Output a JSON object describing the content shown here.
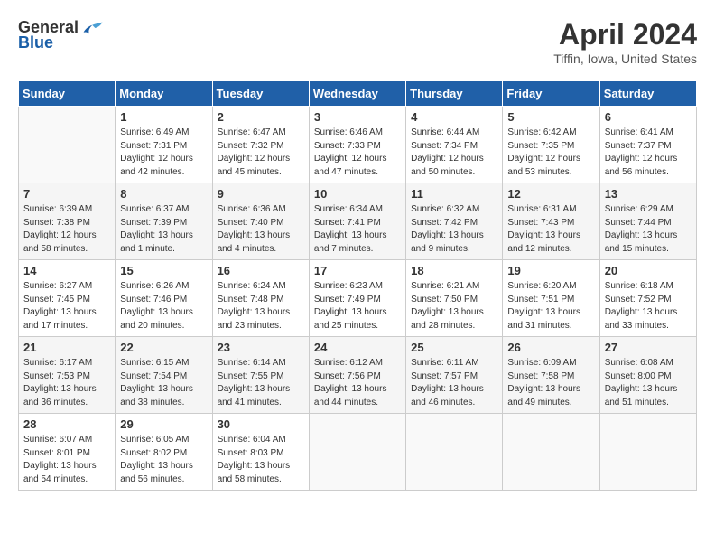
{
  "header": {
    "logo_general": "General",
    "logo_blue": "Blue",
    "title": "April 2024",
    "subtitle": "Tiffin, Iowa, United States"
  },
  "calendar": {
    "headers": [
      "Sunday",
      "Monday",
      "Tuesday",
      "Wednesday",
      "Thursday",
      "Friday",
      "Saturday"
    ],
    "weeks": [
      [
        {
          "day": "",
          "info": ""
        },
        {
          "day": "1",
          "info": "Sunrise: 6:49 AM\nSunset: 7:31 PM\nDaylight: 12 hours\nand 42 minutes."
        },
        {
          "day": "2",
          "info": "Sunrise: 6:47 AM\nSunset: 7:32 PM\nDaylight: 12 hours\nand 45 minutes."
        },
        {
          "day": "3",
          "info": "Sunrise: 6:46 AM\nSunset: 7:33 PM\nDaylight: 12 hours\nand 47 minutes."
        },
        {
          "day": "4",
          "info": "Sunrise: 6:44 AM\nSunset: 7:34 PM\nDaylight: 12 hours\nand 50 minutes."
        },
        {
          "day": "5",
          "info": "Sunrise: 6:42 AM\nSunset: 7:35 PM\nDaylight: 12 hours\nand 53 minutes."
        },
        {
          "day": "6",
          "info": "Sunrise: 6:41 AM\nSunset: 7:37 PM\nDaylight: 12 hours\nand 56 minutes."
        }
      ],
      [
        {
          "day": "7",
          "info": "Sunrise: 6:39 AM\nSunset: 7:38 PM\nDaylight: 12 hours\nand 58 minutes."
        },
        {
          "day": "8",
          "info": "Sunrise: 6:37 AM\nSunset: 7:39 PM\nDaylight: 13 hours\nand 1 minute."
        },
        {
          "day": "9",
          "info": "Sunrise: 6:36 AM\nSunset: 7:40 PM\nDaylight: 13 hours\nand 4 minutes."
        },
        {
          "day": "10",
          "info": "Sunrise: 6:34 AM\nSunset: 7:41 PM\nDaylight: 13 hours\nand 7 minutes."
        },
        {
          "day": "11",
          "info": "Sunrise: 6:32 AM\nSunset: 7:42 PM\nDaylight: 13 hours\nand 9 minutes."
        },
        {
          "day": "12",
          "info": "Sunrise: 6:31 AM\nSunset: 7:43 PM\nDaylight: 13 hours\nand 12 minutes."
        },
        {
          "day": "13",
          "info": "Sunrise: 6:29 AM\nSunset: 7:44 PM\nDaylight: 13 hours\nand 15 minutes."
        }
      ],
      [
        {
          "day": "14",
          "info": "Sunrise: 6:27 AM\nSunset: 7:45 PM\nDaylight: 13 hours\nand 17 minutes."
        },
        {
          "day": "15",
          "info": "Sunrise: 6:26 AM\nSunset: 7:46 PM\nDaylight: 13 hours\nand 20 minutes."
        },
        {
          "day": "16",
          "info": "Sunrise: 6:24 AM\nSunset: 7:48 PM\nDaylight: 13 hours\nand 23 minutes."
        },
        {
          "day": "17",
          "info": "Sunrise: 6:23 AM\nSunset: 7:49 PM\nDaylight: 13 hours\nand 25 minutes."
        },
        {
          "day": "18",
          "info": "Sunrise: 6:21 AM\nSunset: 7:50 PM\nDaylight: 13 hours\nand 28 minutes."
        },
        {
          "day": "19",
          "info": "Sunrise: 6:20 AM\nSunset: 7:51 PM\nDaylight: 13 hours\nand 31 minutes."
        },
        {
          "day": "20",
          "info": "Sunrise: 6:18 AM\nSunset: 7:52 PM\nDaylight: 13 hours\nand 33 minutes."
        }
      ],
      [
        {
          "day": "21",
          "info": "Sunrise: 6:17 AM\nSunset: 7:53 PM\nDaylight: 13 hours\nand 36 minutes."
        },
        {
          "day": "22",
          "info": "Sunrise: 6:15 AM\nSunset: 7:54 PM\nDaylight: 13 hours\nand 38 minutes."
        },
        {
          "day": "23",
          "info": "Sunrise: 6:14 AM\nSunset: 7:55 PM\nDaylight: 13 hours\nand 41 minutes."
        },
        {
          "day": "24",
          "info": "Sunrise: 6:12 AM\nSunset: 7:56 PM\nDaylight: 13 hours\nand 44 minutes."
        },
        {
          "day": "25",
          "info": "Sunrise: 6:11 AM\nSunset: 7:57 PM\nDaylight: 13 hours\nand 46 minutes."
        },
        {
          "day": "26",
          "info": "Sunrise: 6:09 AM\nSunset: 7:58 PM\nDaylight: 13 hours\nand 49 minutes."
        },
        {
          "day": "27",
          "info": "Sunrise: 6:08 AM\nSunset: 8:00 PM\nDaylight: 13 hours\nand 51 minutes."
        }
      ],
      [
        {
          "day": "28",
          "info": "Sunrise: 6:07 AM\nSunset: 8:01 PM\nDaylight: 13 hours\nand 54 minutes."
        },
        {
          "day": "29",
          "info": "Sunrise: 6:05 AM\nSunset: 8:02 PM\nDaylight: 13 hours\nand 56 minutes."
        },
        {
          "day": "30",
          "info": "Sunrise: 6:04 AM\nSunset: 8:03 PM\nDaylight: 13 hours\nand 58 minutes."
        },
        {
          "day": "",
          "info": ""
        },
        {
          "day": "",
          "info": ""
        },
        {
          "day": "",
          "info": ""
        },
        {
          "day": "",
          "info": ""
        }
      ]
    ]
  }
}
